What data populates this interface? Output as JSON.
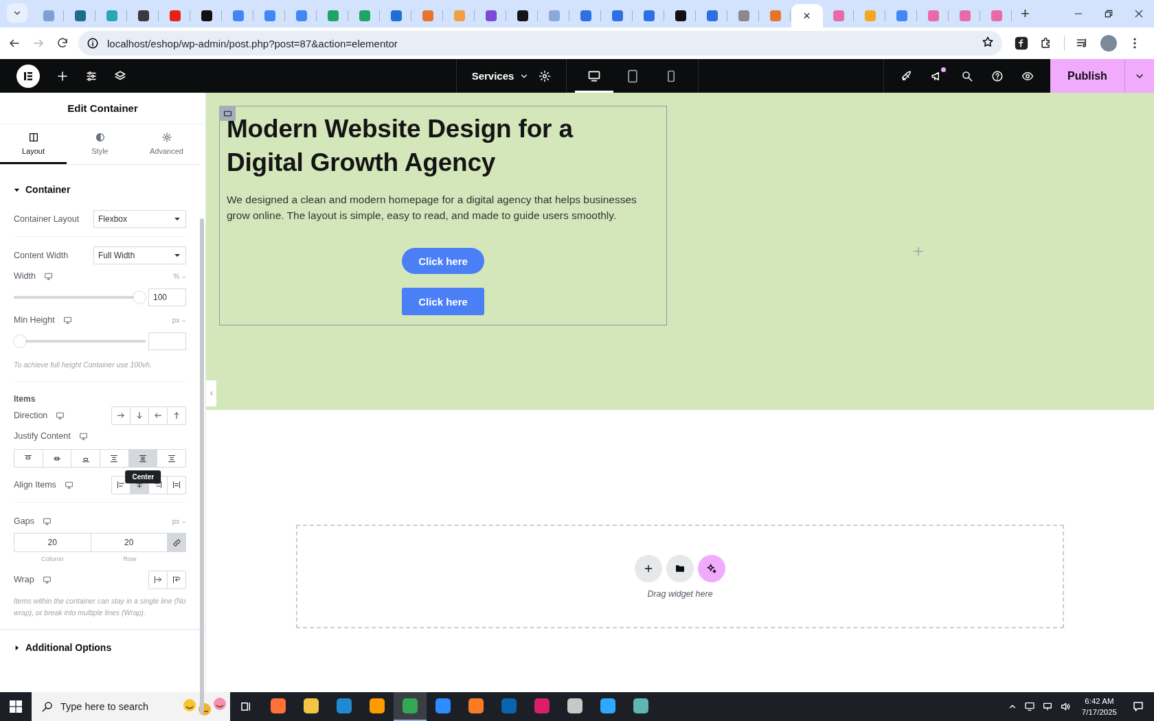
{
  "browser": {
    "tabs": [
      {
        "color": "#7aa0d6",
        "selected": false
      },
      {
        "color": "#1b6d8a",
        "selected": false
      },
      {
        "color": "#2aa6b8",
        "selected": false
      },
      {
        "color": "#3a3a3a",
        "selected": false
      },
      {
        "color": "#e62117",
        "selected": false
      },
      {
        "color": "#111111",
        "selected": false
      },
      {
        "color": "#4285f4",
        "selected": false
      },
      {
        "color": "#4285f4",
        "selected": false
      },
      {
        "color": "#4285f4",
        "selected": false
      },
      {
        "color": "#1fa463",
        "selected": false
      },
      {
        "color": "#1fa463",
        "selected": false
      },
      {
        "color": "#1e6fd9",
        "selected": false
      },
      {
        "color": "#e8742a",
        "selected": false
      },
      {
        "color": "#f0a040",
        "selected": false
      },
      {
        "color": "#7b4ad9",
        "selected": false
      },
      {
        "color": "#141414",
        "selected": false
      },
      {
        "color": "#8aa8d8",
        "selected": false
      },
      {
        "color": "#2f6fe4",
        "selected": false
      },
      {
        "color": "#2f6fe4",
        "selected": false
      },
      {
        "color": "#2f6fe4",
        "selected": false
      },
      {
        "color": "#111111",
        "selected": false
      },
      {
        "color": "#2f6fe4",
        "selected": false
      },
      {
        "color": "#8a8a8a",
        "selected": false
      },
      {
        "color": "#e8742a",
        "selected": false
      },
      {
        "selected": true,
        "close": "×"
      },
      {
        "color": "#e86aa8",
        "selected": false
      },
      {
        "color": "#f5a623",
        "selected": false
      },
      {
        "color": "#4285f4",
        "selected": false
      },
      {
        "color": "#e86aa8",
        "selected": false
      },
      {
        "color": "#e86aa8",
        "selected": false
      },
      {
        "color": "#e86aa8",
        "selected": false
      }
    ],
    "new_tab": "+",
    "forward_disabled": true,
    "url": "localhost/eshop/wp-admin/post.php?post=87&action=elementor"
  },
  "editor_bar": {
    "page_menu": "Services",
    "devices": [
      {
        "kind": "desktop",
        "selected": true
      },
      {
        "kind": "tablet",
        "selected": false
      },
      {
        "kind": "mobile",
        "selected": false
      }
    ],
    "notification": true,
    "publish": "Publish"
  },
  "panel": {
    "title": "Edit Container",
    "tabs": [
      {
        "kind": "layout",
        "label": "Layout",
        "selected": true
      },
      {
        "kind": "style",
        "label": "Style",
        "selected": false
      },
      {
        "kind": "advanced",
        "label": "Advanced",
        "selected": false
      }
    ],
    "section": {
      "title": "Container",
      "expanded": true,
      "controls": [
        {
          "kind": "select",
          "label": "Container Layout",
          "value": "Flexbox"
        },
        {
          "kind": "divider"
        },
        {
          "kind": "select",
          "label": "Content Width",
          "value": "Full Width"
        },
        {
          "kind": "slider",
          "label": "Width",
          "responsive": true,
          "unit": "%",
          "level": 1,
          "value": "100"
        },
        {
          "kind": "slider",
          "label": "Min Height",
          "responsive": true,
          "unit": "px",
          "level": 0
        },
        {
          "kind": "note",
          "text": "To achieve full height Container use 100vh."
        },
        {
          "kind": "divider"
        },
        {
          "kind": "heading",
          "text": "Items"
        },
        {
          "kind": "direction",
          "label": "Direction",
          "responsive": true,
          "options": [
            {
              "selected": false
            },
            {
              "selected": false
            },
            {
              "selected": false
            },
            {
              "selected": false
            }
          ]
        },
        {
          "kind": "justify",
          "label": "Justify Content",
          "responsive": true,
          "options": [
            {
              "selected": false
            },
            {
              "selected": false
            },
            {
              "selected": false
            },
            {
              "selected": false
            },
            {
              "selected": true,
              "tooltip": "Center"
            },
            {
              "selected": false
            }
          ]
        },
        {
          "kind": "align",
          "label": "Align Items",
          "responsive": true,
          "options": [
            {
              "selected": false
            },
            {
              "selected": true
            },
            {
              "selected": false
            },
            {
              "selected": false
            }
          ]
        },
        {
          "kind": "divider"
        },
        {
          "kind": "gaps",
          "label": "Gaps",
          "responsive": true,
          "unit": "px",
          "column": "20",
          "row": "20",
          "column_label": "Column",
          "row_label": "Row",
          "linked": true
        },
        {
          "kind": "wrap",
          "label": "Wrap",
          "responsive": true,
          "options": [
            {
              "selected": false
            },
            {
              "selected": false
            }
          ]
        },
        {
          "kind": "note",
          "text": "Items within the container can stay in a single line (No wrap), or break into multiple lines (Wrap)."
        }
      ]
    },
    "collapsed_section": {
      "title": "Additional Options",
      "expanded": false
    }
  },
  "canvas": {
    "container": {
      "heading": "Modern Website Design for a Digital Growth Agency",
      "text": "We designed a clean and modern homepage for a digital agency that helps businesses grow online. The layout is simple, easy to read, and made to guide users smoothly.",
      "buttons": [
        {
          "kind": "pill",
          "label": "Click here"
        },
        {
          "kind": "square",
          "label": "Click here"
        }
      ]
    },
    "dropzone": {
      "hint": "Drag widget here"
    }
  },
  "taskbar": {
    "search_placeholder": "Type here to search",
    "apps": [
      {
        "color": "#ff7139",
        "selected": false
      },
      {
        "color": "#f4c542",
        "selected": false
      },
      {
        "color": "#1f8ad2",
        "selected": false
      },
      {
        "color": "#ff9a00",
        "selected": false
      },
      {
        "color": "#34a853",
        "selected": true
      },
      {
        "color": "#2d8cff",
        "selected": false
      },
      {
        "color": "#fb7a24",
        "selected": false
      },
      {
        "color": "#0a64ad",
        "selected": false
      },
      {
        "color": "#da1f6a",
        "selected": false
      },
      {
        "color": "#c8c8c8",
        "selected": false
      },
      {
        "color": "#31a8ff",
        "selected": false
      },
      {
        "color": "#5fb8b0",
        "selected": false
      }
    ],
    "time": "6:42 AM",
    "date": "7/17/2025"
  }
}
